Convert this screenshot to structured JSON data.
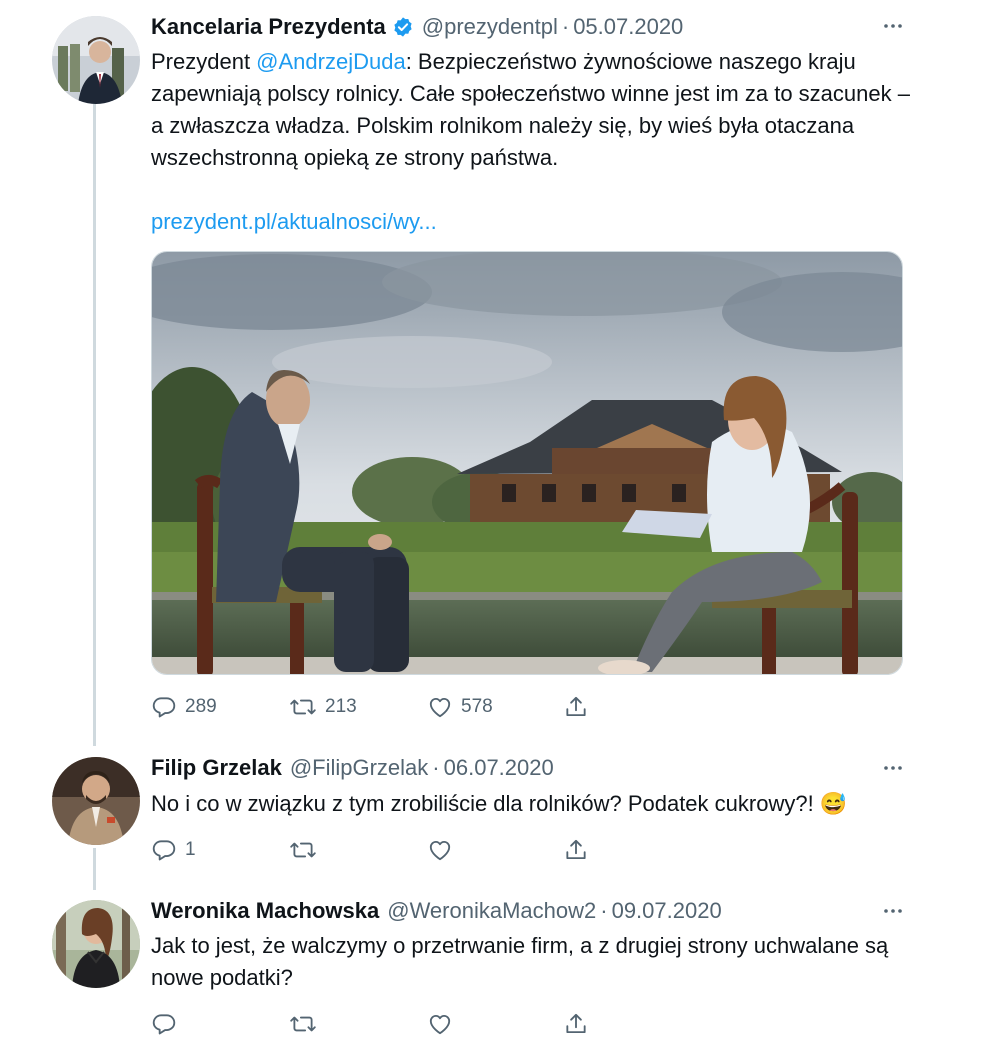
{
  "tweets": [
    {
      "name": "Kancelaria Prezydenta",
      "handle": "@prezydentpl",
      "date": "05.07.2020",
      "body_prefix": "Prezydent ",
      "mention": "@AndrzejDuda",
      "body_rest": ": Bezpieczeństwo żywnościowe naszego kraju zapewniają polscy rolnicy. Całe społeczeństwo winne jest im za to szacunek – a zwłaszcza władza. Polskim rolnikom należy się, by wieś była otaczana wszechstronną opieką ze strony państwa.",
      "link": "prezydent.pl/aktualnosci/wy...",
      "replies": "289",
      "retweets": "213",
      "likes": "578"
    },
    {
      "name": "Filip Grzelak",
      "handle": "@FilipGrzelak",
      "date": "06.07.2020",
      "body": "No i co w związku z tym zrobiliście dla rolników? Podatek cukrowy?! 😅",
      "replies": "1",
      "retweets": "",
      "likes": ""
    },
    {
      "name": "Weronika Machowska",
      "handle": "@WeronikaMachow2",
      "date": "09.07.2020",
      "body": "Jak to jest, że walczymy o przetrwanie firm, a z drugiej strony uchwalane są nowe podatki?",
      "replies": "",
      "retweets": "",
      "likes": ""
    }
  ],
  "separator": "·",
  "icons": {
    "verified": "verified-badge-icon",
    "more": "more-dots-icon",
    "reply": "reply-icon",
    "retweet": "retweet-icon",
    "like": "heart-icon",
    "share": "share-icon"
  },
  "colors": {
    "accent": "#1d9bf0",
    "text": "#0f1419",
    "secondary": "#536471",
    "thread_line": "#cfd9de"
  }
}
